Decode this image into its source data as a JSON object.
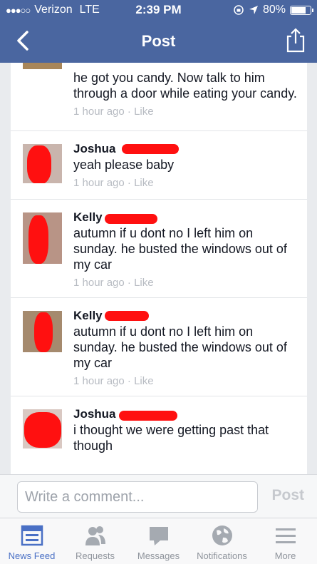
{
  "status_bar": {
    "carrier": "Verizon",
    "network": "LTE",
    "time": "2:39 PM",
    "battery": "80%",
    "battery_level": 0.8
  },
  "nav": {
    "title": "Post"
  },
  "comments": [
    {
      "name": "",
      "text": "he got you candy. Now talk to him through a door while eating your candy.",
      "time": "1 hour ago",
      "like": "Like"
    },
    {
      "name": "Joshua",
      "text": "yeah please baby",
      "time": "1 hour ago",
      "like": "Like"
    },
    {
      "name": "Kelly",
      "text": "autumn if u dont no I left him on sunday. he busted the windows out of my car",
      "time": "1 hour ago",
      "like": "Like"
    },
    {
      "name": "Kelly",
      "text": "autumn if u dont no I left him on sunday. he busted the windows out of my car",
      "time": "1 hour ago",
      "like": "Like"
    },
    {
      "name": "Joshua",
      "text": "i thought we were getting past that though",
      "time": "",
      "like": ""
    }
  ],
  "composer": {
    "placeholder": "Write a comment...",
    "post_label": "Post"
  },
  "tabs": [
    {
      "label": "News Feed",
      "icon": "news-feed-icon"
    },
    {
      "label": "Requests",
      "icon": "friend-requests-icon"
    },
    {
      "label": "Messages",
      "icon": "messages-icon"
    },
    {
      "label": "Notifications",
      "icon": "globe-icon"
    },
    {
      "label": "More",
      "icon": "menu-icon"
    }
  ],
  "colors": {
    "brand": "#4a66a0",
    "active_tab": "#4a70c5",
    "redaction": "#ff1010"
  }
}
